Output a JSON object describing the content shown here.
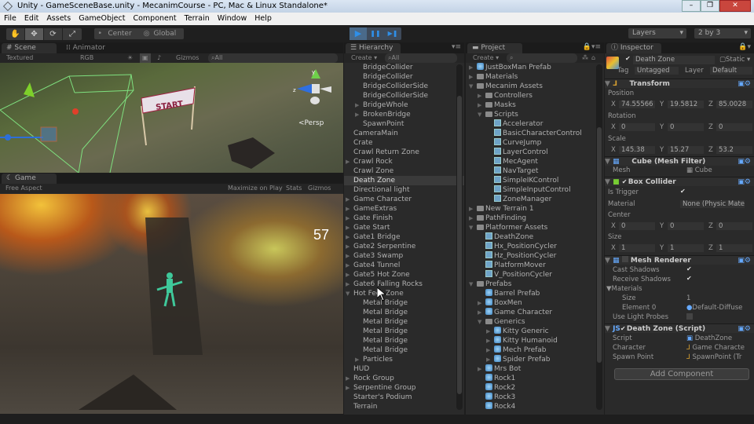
{
  "window": {
    "title": "Unity - GameSceneBase.unity - MecanimCourse - PC, Mac & Linux Standalone*",
    "minimize": "–",
    "maximize": "❐",
    "close": "✕"
  },
  "menu": [
    "File",
    "Edit",
    "Assets",
    "GameObject",
    "Component",
    "Terrain",
    "Window",
    "Help"
  ],
  "toolbar": {
    "tools": [
      "✋",
      "✥",
      "⟳",
      "⤢"
    ],
    "pivot": "Center",
    "space": "Global",
    "play": "▶",
    "pause": "❚❚",
    "step": "▶❚",
    "layers": "Layers",
    "layout": "2 by 3"
  },
  "scene": {
    "tab": "Scene",
    "tab2": "Animator",
    "shading": "Textured",
    "render": "RGB",
    "gizmos": "Gizmos",
    "search": "All",
    "persp": "Persp",
    "banner": "START",
    "axis_y": "y",
    "axis_z": "z"
  },
  "game": {
    "tab": "Game",
    "aspect": "Free Aspect",
    "maximize": "Maximize on Play",
    "stats": "Stats",
    "gizmos": "Gizmos",
    "counter": "57"
  },
  "hierarchy": {
    "tab": "Hierarchy",
    "create": "Create",
    "search": "All",
    "items": [
      {
        "label": "BridgeCollider",
        "indent": 2,
        "arrow": ""
      },
      {
        "label": "BridgeCollider",
        "indent": 2,
        "arrow": ""
      },
      {
        "label": "BridgeColliderSide",
        "indent": 2,
        "arrow": ""
      },
      {
        "label": "BridgeColliderSide",
        "indent": 2,
        "arrow": ""
      },
      {
        "label": "BridgeWhole",
        "indent": 2,
        "arrow": "▶"
      },
      {
        "label": "BrokenBridge",
        "indent": 2,
        "arrow": "▶"
      },
      {
        "label": "SpawnPoint",
        "indent": 2,
        "arrow": ""
      },
      {
        "label": "CameraMain",
        "indent": 1,
        "arrow": ""
      },
      {
        "label": "Crate",
        "indent": 1,
        "arrow": ""
      },
      {
        "label": "Crawl Return Zone",
        "indent": 1,
        "arrow": ""
      },
      {
        "label": "Crawl Rock",
        "indent": 1,
        "arrow": "▶"
      },
      {
        "label": "Crawl Zone",
        "indent": 1,
        "arrow": ""
      },
      {
        "label": "Death Zone",
        "indent": 1,
        "arrow": "",
        "selected": true
      },
      {
        "label": "Directional light",
        "indent": 1,
        "arrow": ""
      },
      {
        "label": "Game Character",
        "indent": 1,
        "arrow": "▶"
      },
      {
        "label": "GameExtras",
        "indent": 1,
        "arrow": "▶"
      },
      {
        "label": "Gate Finish",
        "indent": 1,
        "arrow": "▶"
      },
      {
        "label": "Gate Start",
        "indent": 1,
        "arrow": "▶"
      },
      {
        "label": "Gate1 Bridge",
        "indent": 1,
        "arrow": "▶"
      },
      {
        "label": "Gate2 Serpentine",
        "indent": 1,
        "arrow": "▶"
      },
      {
        "label": "Gate3 Swamp",
        "indent": 1,
        "arrow": "▶"
      },
      {
        "label": "Gate4 Tunnel",
        "indent": 1,
        "arrow": "▶"
      },
      {
        "label": "Gate5 Hot Zone",
        "indent": 1,
        "arrow": "▶"
      },
      {
        "label": "Gate6 Falling Rocks",
        "indent": 1,
        "arrow": "▶"
      },
      {
        "label": "Hot Feet Zone",
        "indent": 1,
        "arrow": "▼"
      },
      {
        "label": "Metal Bridge",
        "indent": 2,
        "arrow": ""
      },
      {
        "label": "Metal Bridge",
        "indent": 2,
        "arrow": ""
      },
      {
        "label": "Metal Bridge",
        "indent": 2,
        "arrow": ""
      },
      {
        "label": "Metal Bridge",
        "indent": 2,
        "arrow": ""
      },
      {
        "label": "Metal Bridge",
        "indent": 2,
        "arrow": ""
      },
      {
        "label": "Metal Bridge",
        "indent": 2,
        "arrow": ""
      },
      {
        "label": "Particles",
        "indent": 2,
        "arrow": "▶"
      },
      {
        "label": "HUD",
        "indent": 1,
        "arrow": ""
      },
      {
        "label": "Rock Group",
        "indent": 1,
        "arrow": "▶"
      },
      {
        "label": "Serpentine Group",
        "indent": 1,
        "arrow": "▶"
      },
      {
        "label": "Starter's Podium",
        "indent": 1,
        "arrow": ""
      },
      {
        "label": "Terrain",
        "indent": 1,
        "arrow": ""
      }
    ]
  },
  "project": {
    "tab": "Project",
    "create": "Create",
    "items": [
      {
        "label": "JustBoxMan Prefab",
        "indent": 0,
        "arrow": "▶",
        "icon": "prefab"
      },
      {
        "label": "Materials",
        "indent": 0,
        "arrow": "▶",
        "icon": "folder"
      },
      {
        "label": "Mecanim Assets",
        "indent": 0,
        "arrow": "▼",
        "icon": "folder"
      },
      {
        "label": "Controllers",
        "indent": 1,
        "arrow": "▶",
        "icon": "folder"
      },
      {
        "label": "Masks",
        "indent": 1,
        "arrow": "▶",
        "icon": "folder"
      },
      {
        "label": "Scripts",
        "indent": 1,
        "arrow": "▼",
        "icon": "folder"
      },
      {
        "label": "Accelerator",
        "indent": 2,
        "arrow": "",
        "icon": "script"
      },
      {
        "label": "BasicCharacterControl",
        "indent": 2,
        "arrow": "",
        "icon": "script"
      },
      {
        "label": "CurveJump",
        "indent": 2,
        "arrow": "",
        "icon": "script"
      },
      {
        "label": "LayerControl",
        "indent": 2,
        "arrow": "",
        "icon": "script"
      },
      {
        "label": "MecAgent",
        "indent": 2,
        "arrow": "",
        "icon": "script"
      },
      {
        "label": "NavTarget",
        "indent": 2,
        "arrow": "",
        "icon": "script"
      },
      {
        "label": "SimpleIKControl",
        "indent": 2,
        "arrow": "",
        "icon": "script"
      },
      {
        "label": "SimpleInputControl",
        "indent": 2,
        "arrow": "",
        "icon": "script"
      },
      {
        "label": "ZoneManager",
        "indent": 2,
        "arrow": "",
        "icon": "script"
      },
      {
        "label": "New Terrain 1",
        "indent": 0,
        "arrow": "▶",
        "icon": "terrain"
      },
      {
        "label": "PathFinding",
        "indent": 0,
        "arrow": "▶",
        "icon": "folder"
      },
      {
        "label": "Platformer Assets",
        "indent": 0,
        "arrow": "▼",
        "icon": "folder"
      },
      {
        "label": "DeathZone",
        "indent": 1,
        "arrow": "",
        "icon": "script"
      },
      {
        "label": "Hx_PositionCycler",
        "indent": 1,
        "arrow": "",
        "icon": "script"
      },
      {
        "label": "Hz_PositionCycler",
        "indent": 1,
        "arrow": "",
        "icon": "script"
      },
      {
        "label": "PlatformMover",
        "indent": 1,
        "arrow": "",
        "icon": "script"
      },
      {
        "label": "V_PositionCycler",
        "indent": 1,
        "arrow": "",
        "icon": "script"
      },
      {
        "label": "Prefabs",
        "indent": 0,
        "arrow": "▼",
        "icon": "folder"
      },
      {
        "label": "Barrel Prefab",
        "indent": 1,
        "arrow": "",
        "icon": "prefab"
      },
      {
        "label": "BoxMen",
        "indent": 1,
        "arrow": "▶",
        "icon": "prefab"
      },
      {
        "label": "Game Character",
        "indent": 1,
        "arrow": "▶",
        "icon": "prefab"
      },
      {
        "label": "Generics",
        "indent": 1,
        "arrow": "▼",
        "icon": "folder"
      },
      {
        "label": "Kitty Generic",
        "indent": 2,
        "arrow": "▶",
        "icon": "prefab"
      },
      {
        "label": "Kitty Humanoid",
        "indent": 2,
        "arrow": "▶",
        "icon": "prefab"
      },
      {
        "label": "Mech Prefab",
        "indent": 2,
        "arrow": "▶",
        "icon": "prefab"
      },
      {
        "label": "Spider Prefab",
        "indent": 2,
        "arrow": "▶",
        "icon": "prefab"
      },
      {
        "label": "Mrs Bot",
        "indent": 1,
        "arrow": "▶",
        "icon": "prefab"
      },
      {
        "label": "Rock1",
        "indent": 1,
        "arrow": "",
        "icon": "prefab"
      },
      {
        "label": "Rock2",
        "indent": 1,
        "arrow": "",
        "icon": "prefab"
      },
      {
        "label": "Rock3",
        "indent": 1,
        "arrow": "",
        "icon": "prefab"
      },
      {
        "label": "Rock4",
        "indent": 1,
        "arrow": "",
        "icon": "prefab"
      }
    ]
  },
  "inspector": {
    "tab": "Inspector",
    "object_name": "Death Zone",
    "static": "Static",
    "tag_label": "Tag",
    "tag": "Untagged",
    "layer_label": "Layer",
    "layer": "Default",
    "transform": {
      "title": "Transform",
      "position_label": "Position",
      "position": {
        "x": "74.55566",
        "y": "19.5812",
        "z": "85.0028"
      },
      "rotation_label": "Rotation",
      "rotation": {
        "x": "0",
        "y": "0",
        "z": "0"
      },
      "scale_label": "Scale",
      "scale": {
        "x": "145.38",
        "y": "15.27",
        "z": "53.2"
      }
    },
    "mesh_filter": {
      "title": "Cube (Mesh Filter)",
      "mesh_label": "Mesh",
      "mesh": "Cube"
    },
    "box_collider": {
      "title": "Box Collider",
      "trigger_label": "Is Trigger",
      "material_label": "Material",
      "material": "None (Physic Mate",
      "center_label": "Center",
      "center": {
        "x": "0",
        "y": "0",
        "z": "0"
      },
      "size_label": "Size",
      "size": {
        "x": "1",
        "y": "1",
        "z": "1"
      }
    },
    "mesh_renderer": {
      "title": "Mesh Renderer",
      "cast_label": "Cast Shadows",
      "receive_label": "Receive Shadows",
      "materials_label": "Materials",
      "size_label": "Size",
      "size": "1",
      "element_label": "Element 0",
      "element": "Default-Diffuse",
      "probes_label": "Use Light Probes"
    },
    "script": {
      "title": "Death Zone (Script)",
      "script_label": "Script",
      "script": "DeathZone",
      "character_label": "Character",
      "character": "Game Characte",
      "spawn_label": "Spawn Point",
      "spawn": "SpawnPoint (Tr"
    },
    "add_component": "Add Component",
    "axis": {
      "x": "X",
      "y": "Y",
      "z": "Z"
    }
  }
}
